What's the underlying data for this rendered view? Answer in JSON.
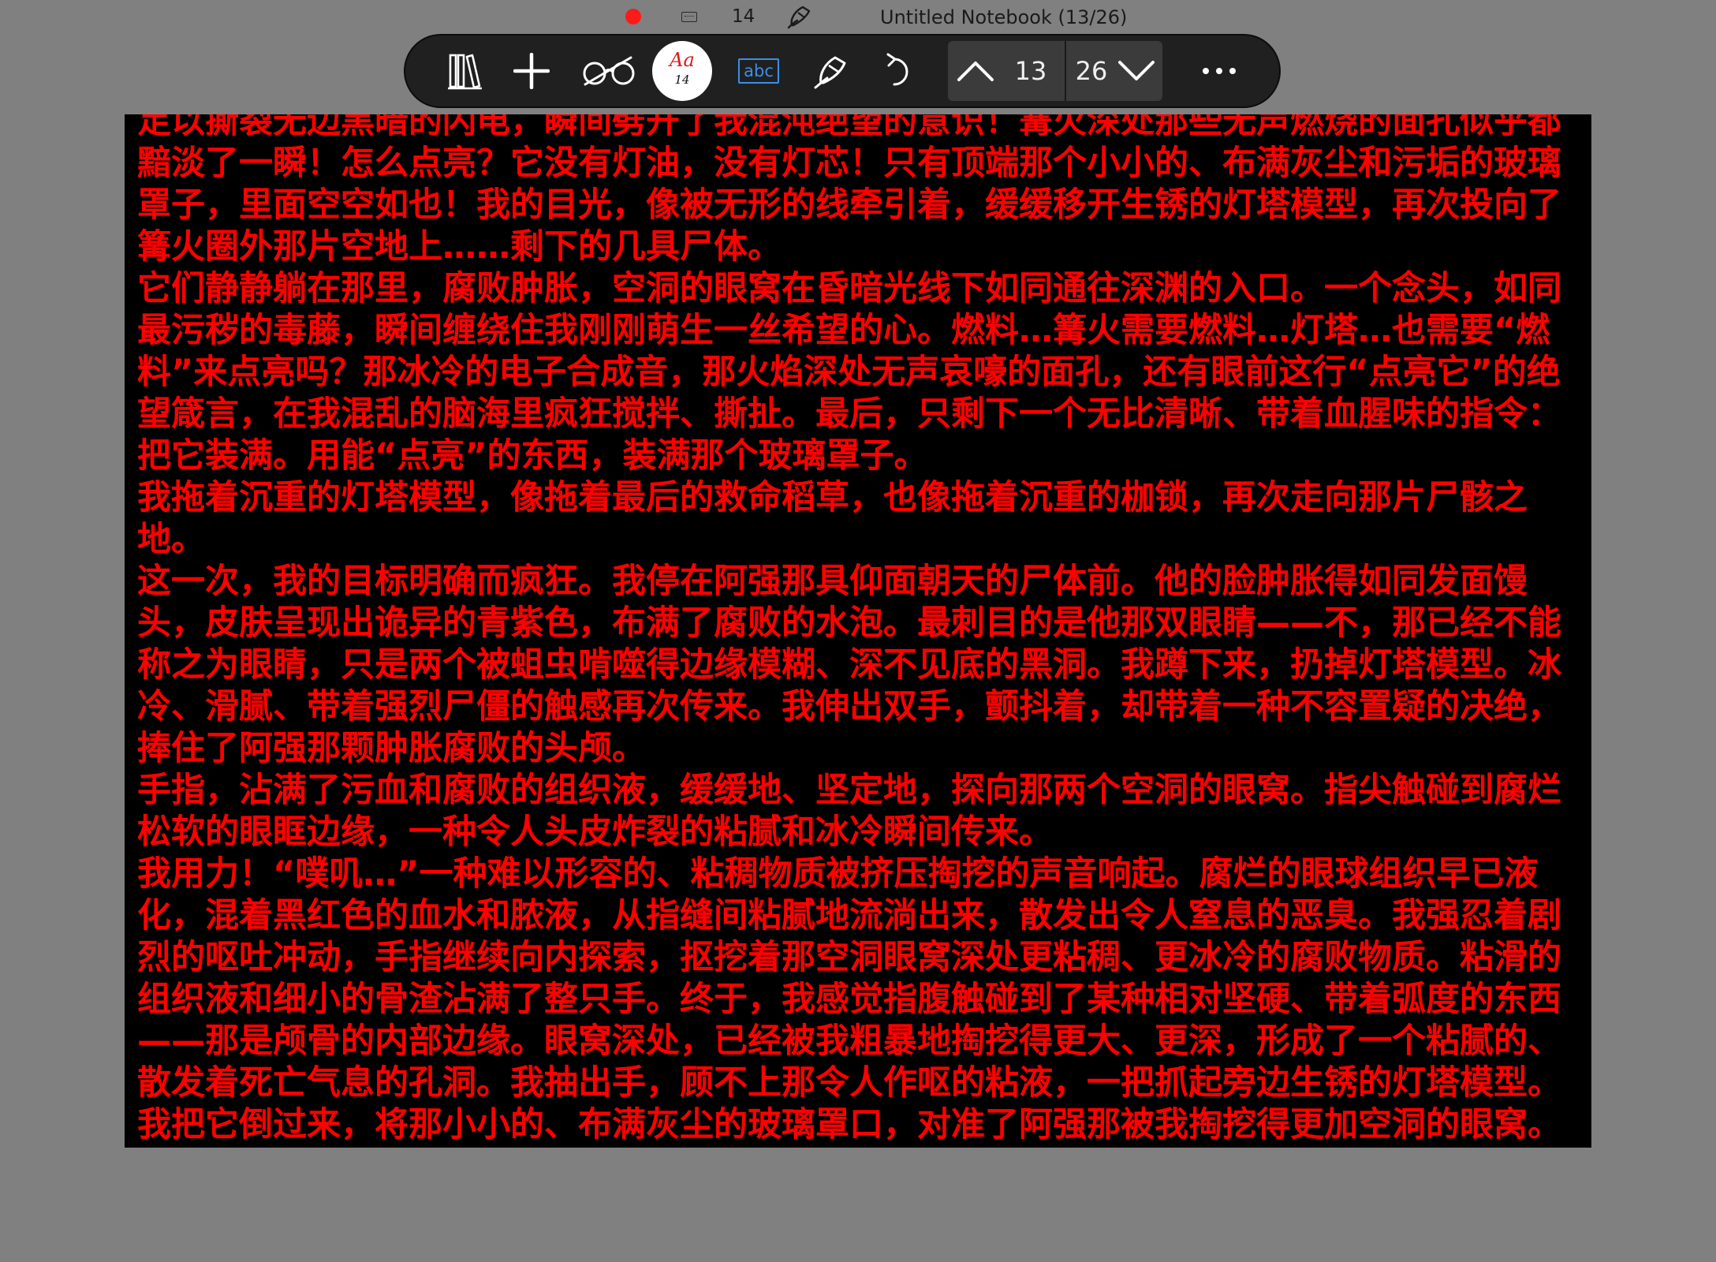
{
  "status": {
    "recording_color": "#ff1a1a",
    "font_size": "14",
    "title": "Untitled Notebook (13/26)",
    "icons": [
      "record-dot-icon",
      "keyboard-icon",
      "pen-icon"
    ]
  },
  "toolbar": {
    "font_button": {
      "glyph": "Aa",
      "size": "14",
      "color": "#e0191d"
    },
    "abc_label": "abc",
    "page_current": "13",
    "page_total": "26",
    "icons": [
      "library-icon",
      "add-icon",
      "reading-glasses-icon",
      "text-recognition-icon",
      "pen-tool-icon",
      "undo-icon",
      "chevron-up-icon",
      "chevron-down-icon",
      "more-icon"
    ]
  },
  "page": {
    "text_color": "#ff0000",
    "background": "#000000",
    "paragraphs": [
      "足以撕裂无边黑暗的闪电，瞬间劈开了我混沌绝望的意识！篝火深处那些无声燃烧的面孔似乎都黯淡了一瞬！怎么点亮？它没有灯油，没有灯芯！只有顶端那个小小的、布满灰尘和污垢的玻璃罩子，里面空空如也！我的目光，像被无形的线牵引着，缓缓移开生锈的灯塔模型，再次投向了篝火圈外那片空地上……剩下的几具尸体。",
      "它们静静躺在那里，腐败肿胀，空洞的眼窝在昏暗光线下如同通往深渊的入口。一个念头，如同最污秽的毒藤，瞬间缠绕住我刚刚萌生一丝希望的心。燃料…篝火需要燃料…灯塔…也需要“燃料”来点亮吗？那冰冷的电子合成音，那火焰深处无声哀嚎的面孔，还有眼前这行“点亮它”的绝望箴言，在我混乱的脑海里疯狂搅拌、撕扯。最后，只剩下一个无比清晰、带着血腥味的指令：把它装满。用能“点亮”的东西，装满那个玻璃罩子。",
      "我拖着沉重的灯塔模型，像拖着最后的救命稻草，也像拖着沉重的枷锁，再次走向那片尸骸之地。",
      "这一次，我的目标明确而疯狂。我停在阿强那具仰面朝天的尸体前。他的脸肿胀得如同发面馒头，皮肤呈现出诡异的青紫色，布满了腐败的水泡。最刺目的是他那双眼睛——不，那已经不能称之为眼睛，只是两个被蛆虫啃噬得边缘模糊、深不见底的黑洞。我蹲下来，扔掉灯塔模型。冰冷、滑腻、带着强烈尸僵的触感再次传来。我伸出双手，颤抖着，却带着一种不容置疑的决绝，捧住了阿强那颗肿胀腐败的头颅。",
      "手指，沾满了污血和腐败的组织液，缓缓地、坚定地，探向那两个空洞的眼窝。指尖触碰到腐烂松软的眼眶边缘，一种令人头皮炸裂的粘腻和冰冷瞬间传来。",
      "我用力！“噗叽…”一种难以形容的、粘稠物质被挤压掏挖的声音响起。腐烂的眼球组织早已液化，混着黑红色的血水和脓液，从指缝间粘腻地流淌出来，散发出令人窒息的恶臭。我强忍着剧烈的呕吐冲动，手指继续向内探索，抠挖着那空洞眼窝深处更粘稠、更冰冷的腐败物质。粘滑的组织液和细小的骨渣沾满了整只手。终于，我感觉指腹触碰到了某种相对坚硬、带着弧度的东西——那是颅骨的内部边缘。眼窝深处，已经被我粗暴地掏挖得更大、更深，形成了一个粘腻的、散发着死亡气息的孔洞。我抽出手，顾不上那令人作呕的粘液，一把抓起旁边生锈的灯塔模型。我把它倒过来，将那小小的、布满灰尘的玻璃罩口，对准了阿强那被我掏挖得更加空洞的眼窝。"
    ]
  }
}
